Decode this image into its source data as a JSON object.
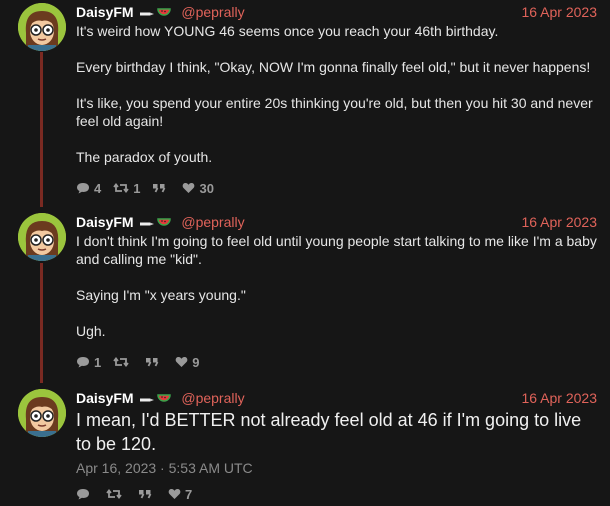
{
  "posts": [
    {
      "display_name": "DaisyFM",
      "handle": "@peprally",
      "date": "16 Apr 2023",
      "paragraphs": [
        "It's weird how YOUNG 46 seems once you reach your 46th birthday.",
        "Every birthday I think, \"Okay, NOW I'm gonna finally feel old,\" but it never happens!",
        "It's like, you spend your entire 20s thinking you're old, but then you hit 30 and never feel old again!",
        "The paradox of youth."
      ],
      "stats": {
        "replies": "4",
        "reposts": "1",
        "quotes": "",
        "likes": "30"
      }
    },
    {
      "display_name": "DaisyFM",
      "handle": "@peprally",
      "date": "16 Apr 2023",
      "paragraphs": [
        "I don't think I'm going to feel old until young people start talking to me like I'm a baby and calling me \"kid\".",
        "Saying I'm \"x years young.\"",
        "Ugh."
      ],
      "stats": {
        "replies": "1",
        "reposts": "",
        "quotes": "",
        "likes": "9"
      }
    },
    {
      "display_name": "DaisyFM",
      "handle": "@peprally",
      "date": "16 Apr 2023",
      "body": "I mean, I'd BETTER not already feel old at 46 if I'm going to live to be 120.",
      "timestamp": "Apr 16, 2023 · 5:53 AM UTC",
      "stats": {
        "replies": "",
        "reposts": "",
        "quotes": "",
        "likes": "7"
      }
    }
  ],
  "colors": {
    "background": "#161616",
    "accent": "#e0635a",
    "thread_line": "#7a2a22",
    "avatar_bg": "#9bc53d"
  },
  "icons": [
    "comment-icon",
    "repost-icon",
    "quote-icon",
    "heart-icon",
    "pencil-badge-icon",
    "watermelon-badge-icon"
  ]
}
